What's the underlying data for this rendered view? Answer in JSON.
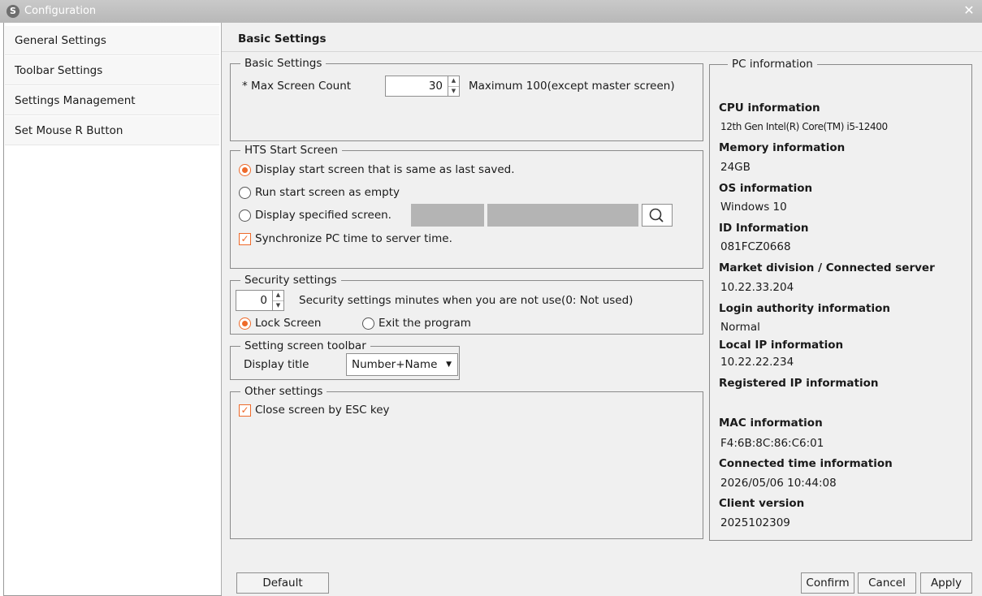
{
  "window": {
    "title": "Configuration",
    "logo_glyph": "S",
    "close_glyph": "✕"
  },
  "sidebar": {
    "items": [
      {
        "label": "General Settings"
      },
      {
        "label": "Toolbar Settings"
      },
      {
        "label": "Settings Management"
      },
      {
        "label": "Set Mouse R Button"
      }
    ]
  },
  "main": {
    "title": "Basic Settings"
  },
  "basic_settings": {
    "legend": "Basic Settings",
    "max_screen_label": "* Max Screen Count",
    "max_screen_value": "30",
    "max_screen_hint": "Maximum 100(except master screen)"
  },
  "hts_start": {
    "legend": "HTS Start Screen",
    "option_last_saved": "Display start screen that is same as last saved.",
    "option_empty": "Run start screen as empty",
    "option_specified": "Display specified screen.",
    "selected_option": "last_saved",
    "sync_time_label": "Synchronize PC time to server time.",
    "sync_time_checked": true
  },
  "security": {
    "legend": "Security settings",
    "minutes_value": "0",
    "minutes_label": "Security settings minutes when you are not use(0: Not used)",
    "option_lock": "Lock Screen",
    "option_exit": "Exit the program",
    "selected_option": "lock"
  },
  "toolbar": {
    "legend": "Setting screen toolbar",
    "display_title_label": "Display title",
    "display_title_value": "Number+Name"
  },
  "other": {
    "legend": "Other settings",
    "esc_close_label": "Close screen by ESC key",
    "esc_close_checked": true
  },
  "pc_info": {
    "legend": "PC information",
    "cpu_label": "CPU information",
    "cpu_value": "12th Gen Intel(R) Core(TM) i5-12400",
    "memory_label": "Memory information",
    "memory_value": "24GB",
    "os_label": "OS information",
    "os_value": "Windows 10",
    "id_label": "ID Information",
    "id_value": "081FCZ0668",
    "market_label": "Market division / Connected server",
    "market_value": "10.22.33.204",
    "login_label": "Login authority information",
    "login_value": "Normal",
    "local_ip_label": "Local IP information",
    "local_ip_value": "10.22.22.234",
    "registered_ip_label": "Registered IP information",
    "registered_ip_value": "",
    "mac_label": "MAC information",
    "mac_value": "F4:6B:8C:86:C6:01",
    "connected_time_label": "Connected time information",
    "connected_time_value": "2026/05/06 10:44:08",
    "client_version_label": "Client version",
    "client_version_value": "2025102309"
  },
  "buttons": {
    "default": "Default",
    "confirm": "Confirm",
    "cancel": "Cancel",
    "apply": "Apply"
  },
  "icons": {
    "check_glyph": "✓",
    "caret_glyph": "▼",
    "spin_up": "▲",
    "spin_down": "▼"
  },
  "colors": {
    "accent": "#ee6a2a",
    "titlebar": "#bfbfbf",
    "panel_bg": "#f0f0f0"
  }
}
